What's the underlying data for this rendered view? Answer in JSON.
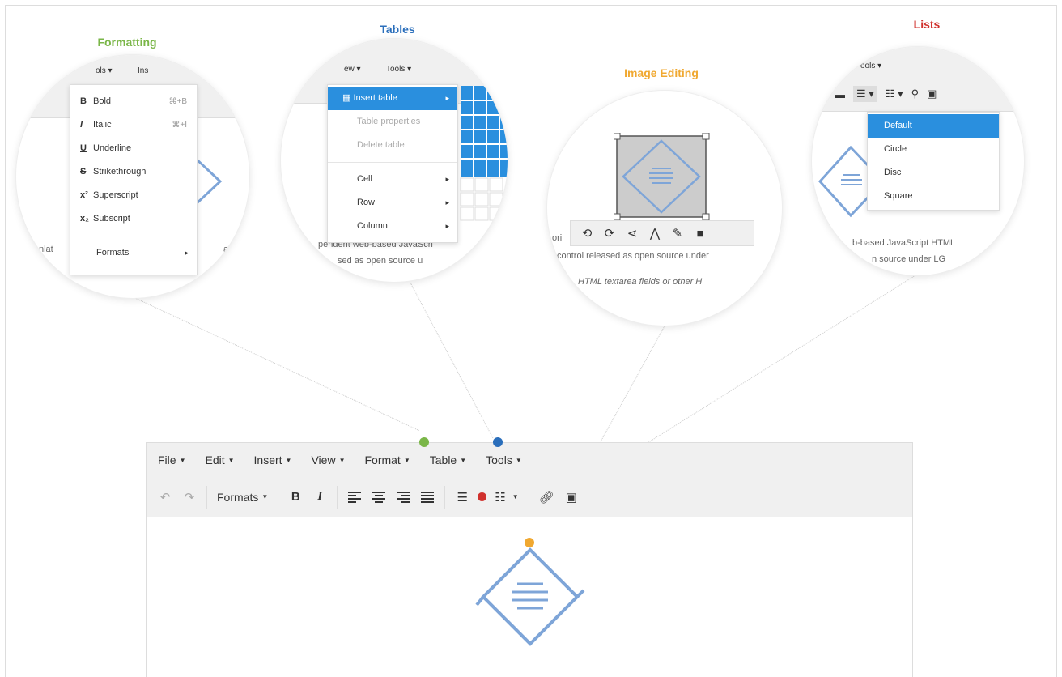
{
  "callouts": {
    "formatting": {
      "title": "Formatting",
      "color": "#7ab648",
      "top_tabs": [
        "ols ▾",
        "Ins"
      ],
      "items": [
        {
          "icon": "B",
          "label": "Bold",
          "shortcut": "⌘+B"
        },
        {
          "icon": "I",
          "label": "Italic",
          "shortcut": "⌘+I"
        },
        {
          "icon": "U",
          "label": "Underline",
          "shortcut": ""
        },
        {
          "icon": "S",
          "label": "Strikethrough",
          "shortcut": ""
        },
        {
          "icon": "x²",
          "label": "Superscript",
          "shortcut": ""
        },
        {
          "icon": "x₂",
          "label": "Subscript",
          "shortcut": ""
        }
      ],
      "formats_label": "Formats",
      "side_text_left": "nlat",
      "side_text_right": "asc"
    },
    "tables": {
      "title": "Tables",
      "color": "#2a6ebb",
      "top_tabs": [
        "ew ▾",
        "Tools ▾"
      ],
      "items": [
        "Insert table",
        "Table properties",
        "Delete table",
        "Cell",
        "Row",
        "Column"
      ],
      "faded_line1": "pendent web-based JavaScri",
      "faded_line2": "sed as open source u"
    },
    "image_editing": {
      "title": "Image Editing",
      "color": "#f0a830",
      "faded_line1": "control released as open source under",
      "faded_line2": "HTML textarea fields or other H",
      "faded_prefix": "ori"
    },
    "lists": {
      "title": "Lists",
      "color": "#d0312d",
      "top_tab": "ools ▾",
      "items": [
        "Default",
        "Circle",
        "Disc",
        "Square"
      ],
      "faded_line1": "b-based JavaScript HTML",
      "faded_line2": "n source under LG"
    }
  },
  "editor": {
    "menus": [
      "File",
      "Edit",
      "Insert",
      "View",
      "Format",
      "Table",
      "Tools"
    ],
    "formats_label": "Formats",
    "bold_label": "B",
    "italic_label": "I"
  },
  "colors": {
    "green": "#7ab648",
    "blue": "#2a6ebb",
    "orange": "#f0a830",
    "red": "#d0312d",
    "selection": "#2a8fde",
    "logo": "#7ea5d8"
  }
}
